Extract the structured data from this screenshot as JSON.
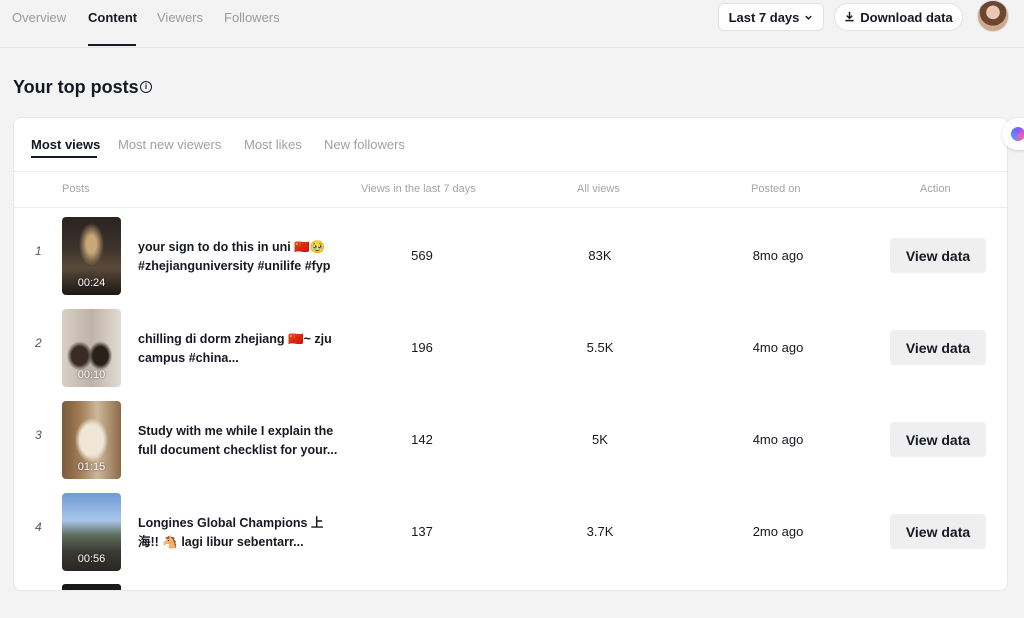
{
  "nav": {
    "tabs": [
      "Overview",
      "Content",
      "Viewers",
      "Followers"
    ],
    "date_range": "Last 7 days",
    "download_label": "Download data"
  },
  "section": {
    "title": "Your top posts"
  },
  "subtabs": [
    "Most views",
    "Most new viewers",
    "Most likes",
    "New followers"
  ],
  "columns": [
    "Posts",
    "Views in the last 7 days",
    "All views",
    "Posted on",
    "Action"
  ],
  "rows": [
    {
      "rank": "1",
      "duration": "00:24",
      "caption_line1": "your sign to do this in uni 🇨🇳🥹",
      "caption_line2": "#zhejianguniversity #unilife #fyp",
      "views7": "569",
      "all_views": "83K",
      "posted": "8mo ago",
      "action": "View data"
    },
    {
      "rank": "2",
      "duration": "00:10",
      "caption_line1": "chilling di dorm zhejiang 🇨🇳~ zju",
      "caption_line2": "campus #china...",
      "views7": "196",
      "all_views": "5.5K",
      "posted": "4mo ago",
      "action": "View data"
    },
    {
      "rank": "3",
      "duration": "01:15",
      "caption_line1": "Study with me while I explain the",
      "caption_line2": "full document checklist for your...",
      "views7": "142",
      "all_views": "5K",
      "posted": "4mo ago",
      "action": "View data"
    },
    {
      "rank": "4",
      "duration": "00:56",
      "caption_line1": "Longines Global Champions 上",
      "caption_line2": "海!! 🐴 lagi libur sebentarr...",
      "views7": "137",
      "all_views": "3.7K",
      "posted": "2mo ago",
      "action": "View data"
    }
  ]
}
